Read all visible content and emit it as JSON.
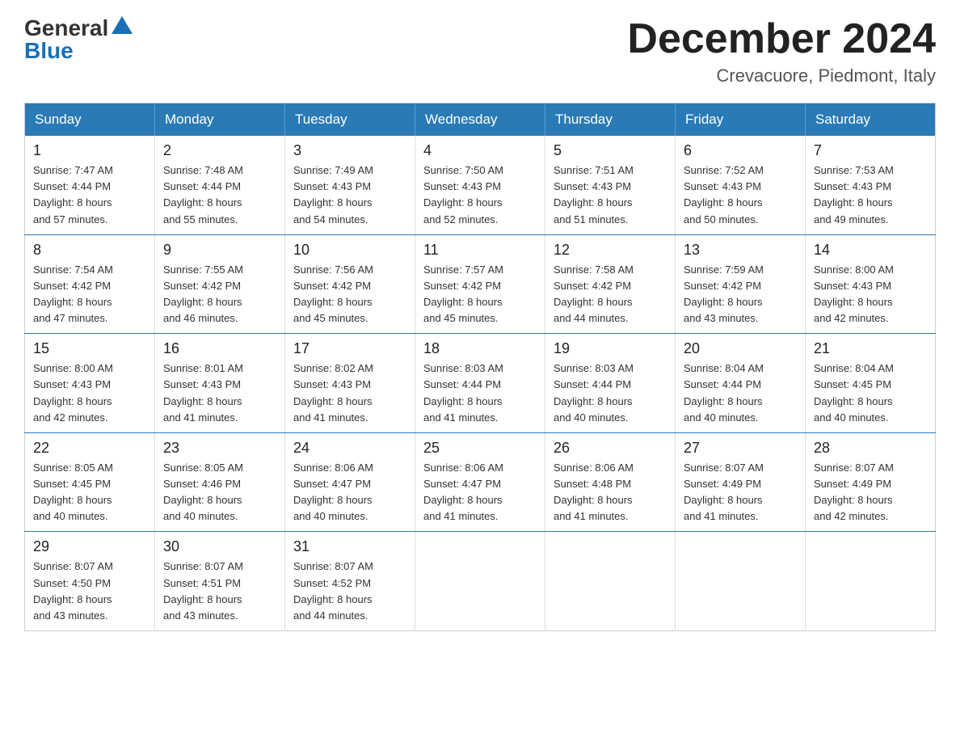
{
  "logo": {
    "general": "General",
    "blue": "Blue",
    "arrow_char": "▲"
  },
  "title": "December 2024",
  "location": "Crevacuore, Piedmont, Italy",
  "headers": [
    "Sunday",
    "Monday",
    "Tuesday",
    "Wednesday",
    "Thursday",
    "Friday",
    "Saturday"
  ],
  "weeks": [
    [
      {
        "day": "1",
        "sunrise": "7:47 AM",
        "sunset": "4:44 PM",
        "daylight": "8 hours and 57 minutes."
      },
      {
        "day": "2",
        "sunrise": "7:48 AM",
        "sunset": "4:44 PM",
        "daylight": "8 hours and 55 minutes."
      },
      {
        "day": "3",
        "sunrise": "7:49 AM",
        "sunset": "4:43 PM",
        "daylight": "8 hours and 54 minutes."
      },
      {
        "day": "4",
        "sunrise": "7:50 AM",
        "sunset": "4:43 PM",
        "daylight": "8 hours and 52 minutes."
      },
      {
        "day": "5",
        "sunrise": "7:51 AM",
        "sunset": "4:43 PM",
        "daylight": "8 hours and 51 minutes."
      },
      {
        "day": "6",
        "sunrise": "7:52 AM",
        "sunset": "4:43 PM",
        "daylight": "8 hours and 50 minutes."
      },
      {
        "day": "7",
        "sunrise": "7:53 AM",
        "sunset": "4:43 PM",
        "daylight": "8 hours and 49 minutes."
      }
    ],
    [
      {
        "day": "8",
        "sunrise": "7:54 AM",
        "sunset": "4:42 PM",
        "daylight": "8 hours and 47 minutes."
      },
      {
        "day": "9",
        "sunrise": "7:55 AM",
        "sunset": "4:42 PM",
        "daylight": "8 hours and 46 minutes."
      },
      {
        "day": "10",
        "sunrise": "7:56 AM",
        "sunset": "4:42 PM",
        "daylight": "8 hours and 45 minutes."
      },
      {
        "day": "11",
        "sunrise": "7:57 AM",
        "sunset": "4:42 PM",
        "daylight": "8 hours and 45 minutes."
      },
      {
        "day": "12",
        "sunrise": "7:58 AM",
        "sunset": "4:42 PM",
        "daylight": "8 hours and 44 minutes."
      },
      {
        "day": "13",
        "sunrise": "7:59 AM",
        "sunset": "4:42 PM",
        "daylight": "8 hours and 43 minutes."
      },
      {
        "day": "14",
        "sunrise": "8:00 AM",
        "sunset": "4:43 PM",
        "daylight": "8 hours and 42 minutes."
      }
    ],
    [
      {
        "day": "15",
        "sunrise": "8:00 AM",
        "sunset": "4:43 PM",
        "daylight": "8 hours and 42 minutes."
      },
      {
        "day": "16",
        "sunrise": "8:01 AM",
        "sunset": "4:43 PM",
        "daylight": "8 hours and 41 minutes."
      },
      {
        "day": "17",
        "sunrise": "8:02 AM",
        "sunset": "4:43 PM",
        "daylight": "8 hours and 41 minutes."
      },
      {
        "day": "18",
        "sunrise": "8:03 AM",
        "sunset": "4:44 PM",
        "daylight": "8 hours and 41 minutes."
      },
      {
        "day": "19",
        "sunrise": "8:03 AM",
        "sunset": "4:44 PM",
        "daylight": "8 hours and 40 minutes."
      },
      {
        "day": "20",
        "sunrise": "8:04 AM",
        "sunset": "4:44 PM",
        "daylight": "8 hours and 40 minutes."
      },
      {
        "day": "21",
        "sunrise": "8:04 AM",
        "sunset": "4:45 PM",
        "daylight": "8 hours and 40 minutes."
      }
    ],
    [
      {
        "day": "22",
        "sunrise": "8:05 AM",
        "sunset": "4:45 PM",
        "daylight": "8 hours and 40 minutes."
      },
      {
        "day": "23",
        "sunrise": "8:05 AM",
        "sunset": "4:46 PM",
        "daylight": "8 hours and 40 minutes."
      },
      {
        "day": "24",
        "sunrise": "8:06 AM",
        "sunset": "4:47 PM",
        "daylight": "8 hours and 40 minutes."
      },
      {
        "day": "25",
        "sunrise": "8:06 AM",
        "sunset": "4:47 PM",
        "daylight": "8 hours and 41 minutes."
      },
      {
        "day": "26",
        "sunrise": "8:06 AM",
        "sunset": "4:48 PM",
        "daylight": "8 hours and 41 minutes."
      },
      {
        "day": "27",
        "sunrise": "8:07 AM",
        "sunset": "4:49 PM",
        "daylight": "8 hours and 41 minutes."
      },
      {
        "day": "28",
        "sunrise": "8:07 AM",
        "sunset": "4:49 PM",
        "daylight": "8 hours and 42 minutes."
      }
    ],
    [
      {
        "day": "29",
        "sunrise": "8:07 AM",
        "sunset": "4:50 PM",
        "daylight": "8 hours and 43 minutes."
      },
      {
        "day": "30",
        "sunrise": "8:07 AM",
        "sunset": "4:51 PM",
        "daylight": "8 hours and 43 minutes."
      },
      {
        "day": "31",
        "sunrise": "8:07 AM",
        "sunset": "4:52 PM",
        "daylight": "8 hours and 44 minutes."
      },
      null,
      null,
      null,
      null
    ]
  ],
  "day_labels": {
    "sunrise": "Sunrise:",
    "sunset": "Sunset:",
    "daylight": "Daylight:"
  }
}
